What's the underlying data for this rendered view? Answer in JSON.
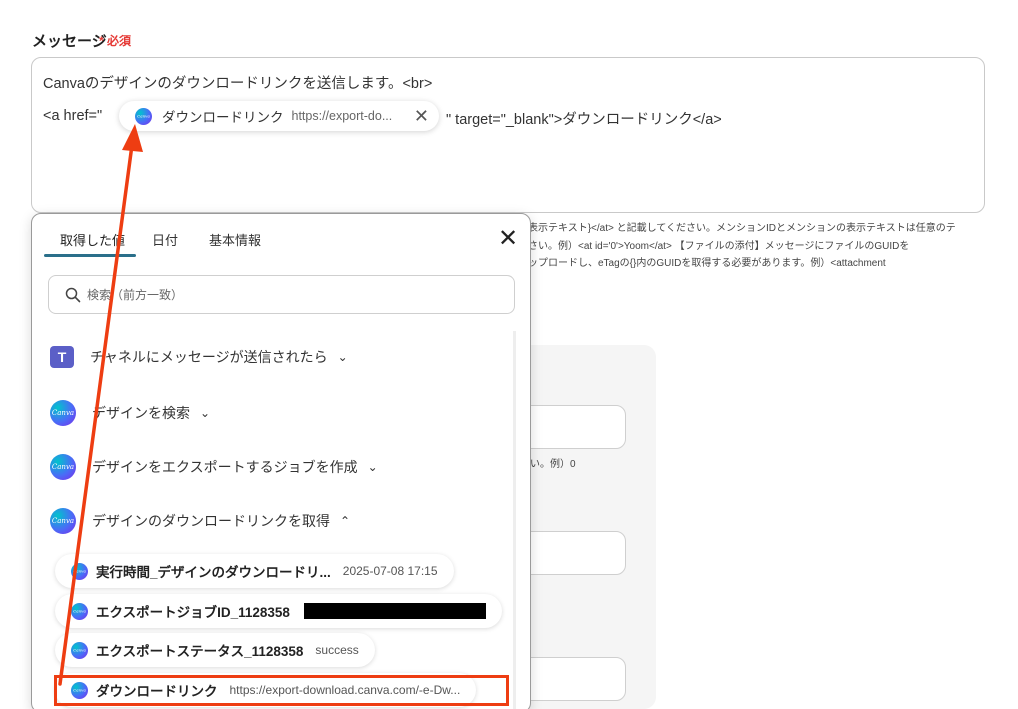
{
  "field": {
    "label": "メッセージ",
    "required": "* 必須"
  },
  "message": {
    "line1": "Canvaのデザインのダウンロードリンクを送信します。<br>",
    "line2_before": "<a href=\"",
    "line2_after": "\" target=\"_blank\">ダウンロードリンク</a>",
    "chip": {
      "label": "ダウンロードリンク",
      "value": "https://export-do...",
      "icon": "canva-icon"
    }
  },
  "hints": {
    "line1": "表示テキスト}</at> と記載してください。メンションIDとメンションの表示テキストは任意のテ",
    "line2": "さい。例）<at id='0'>Yoom</at>  【ファイルの添付】メッセージにファイルのGUIDを",
    "line3": "ップロードし、eTagの{}内のGUIDを取得する必要があります。例）<attachment",
    "bg": "さい。例）0"
  },
  "popup": {
    "tabs": [
      "取得した値",
      "日付",
      "基本情報"
    ],
    "search_placeholder": "検索（前方一致）",
    "groups": [
      {
        "label": "チャネルにメッセージが送信されたら",
        "icon": "teams-icon",
        "chevron": "⌄"
      },
      {
        "label": "デザインを検索",
        "icon": "canva-icon",
        "chevron": "⌄"
      },
      {
        "label": "デザインをエクスポートするジョブを作成",
        "icon": "canva-icon",
        "chevron": "⌄"
      },
      {
        "label": "デザインのダウンロードリンクを取得",
        "icon": "canva-icon",
        "chevron": "⌃"
      }
    ],
    "items": [
      {
        "label": "実行時間_デザインのダウンロードリ...",
        "value": "2025-07-08 17:15"
      },
      {
        "label": "エクスポートジョブID_1128358",
        "value": ""
      },
      {
        "label": "エクスポートステータス_1128358",
        "value": "success"
      },
      {
        "label": "ダウンロードリンク",
        "value": "https://export-download.canva.com/-e-Dw..."
      }
    ]
  },
  "colors": {
    "annotation": "#ee3d12",
    "tab_accent": "#2a6f8a",
    "required": "#e53935"
  }
}
